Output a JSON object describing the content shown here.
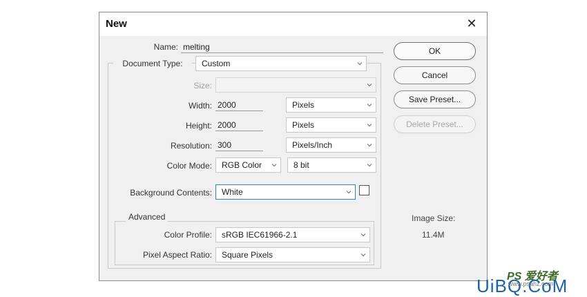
{
  "dialog": {
    "title": "New"
  },
  "form": {
    "name_label": "Name:",
    "name_value": "melting",
    "doc_type_label": "Document Type:",
    "doc_type_value": "Custom",
    "size_label": "Size:",
    "size_value": "",
    "width_label": "Width:",
    "width_value": "2000",
    "width_unit": "Pixels",
    "height_label": "Height:",
    "height_value": "2000",
    "height_unit": "Pixels",
    "resolution_label": "Resolution:",
    "resolution_value": "300",
    "resolution_unit": "Pixels/Inch",
    "color_mode_label": "Color Mode:",
    "color_mode_value": "RGB Color",
    "bit_depth_value": "8 bit",
    "bg_label": "Background Contents:",
    "bg_value": "White",
    "bg_swatch_color": "#ffffff"
  },
  "advanced": {
    "title": "Advanced",
    "color_profile_label": "Color Profile:",
    "color_profile_value": "sRGB IEC61966-2.1",
    "pixel_aspect_label": "Pixel Aspect Ratio:",
    "pixel_aspect_value": "Square Pixels"
  },
  "buttons": {
    "ok": "OK",
    "cancel": "Cancel",
    "save_preset": "Save Preset...",
    "delete_preset": "Delete Preset..."
  },
  "image_size": {
    "label": "Image Size:",
    "value": "11.4M"
  },
  "watermark": {
    "top": "PS 爱好者",
    "main": "UiBQ.CoM",
    "url": "www.psahz.com"
  },
  "colors": {
    "focus_border": "#2f7fd3",
    "dialog_bg": "#f0f0f0",
    "watermark_blue": "#1a63a8"
  }
}
